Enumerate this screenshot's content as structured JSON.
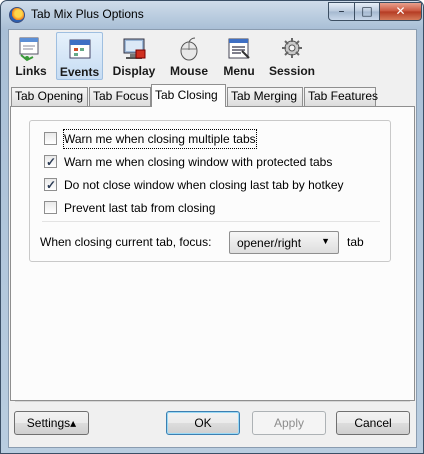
{
  "window": {
    "title": "Tab Mix Plus Options",
    "min_glyph": "–",
    "max_glyph": "□",
    "close_glyph": "✕"
  },
  "toolbar": {
    "items": [
      {
        "label": "Links",
        "icon": "links-icon",
        "selected": false
      },
      {
        "label": "Events",
        "icon": "events-icon",
        "selected": true
      },
      {
        "label": "Display",
        "icon": "display-icon",
        "selected": false
      },
      {
        "label": "Mouse",
        "icon": "mouse-icon",
        "selected": false
      },
      {
        "label": "Menu",
        "icon": "menu-icon",
        "selected": false
      },
      {
        "label": "Session",
        "icon": "session-icon",
        "selected": false
      }
    ]
  },
  "tabs": [
    {
      "label": "Tab Opening",
      "active": false
    },
    {
      "label": "Tab Focus",
      "active": false
    },
    {
      "label": "Tab Closing",
      "active": true
    },
    {
      "label": "Tab Merging",
      "active": false
    },
    {
      "label": "Tab Features",
      "active": false
    }
  ],
  "options": [
    {
      "label": "Warn me when closing multiple tabs",
      "checked": false,
      "focused": true
    },
    {
      "label": "Warn me when closing window with protected tabs",
      "checked": true,
      "focused": false
    },
    {
      "label": "Do not close window when closing last tab by hotkey",
      "checked": true,
      "focused": false
    },
    {
      "label": "Prevent last tab from closing",
      "checked": false,
      "focused": false
    }
  ],
  "focus_setting": {
    "label": "When closing current tab, focus:",
    "value": "opener/right",
    "suffix": "tab"
  },
  "buttons": {
    "settings": "Settings",
    "settings_arrow": "▴",
    "ok": "OK",
    "apply": "Apply",
    "cancel": "Cancel"
  },
  "colors": {
    "selected_toolbar_bg": "#c6dcf3",
    "titlebar": "#a9bfd6",
    "default_button_border": "#3c7fb1"
  }
}
